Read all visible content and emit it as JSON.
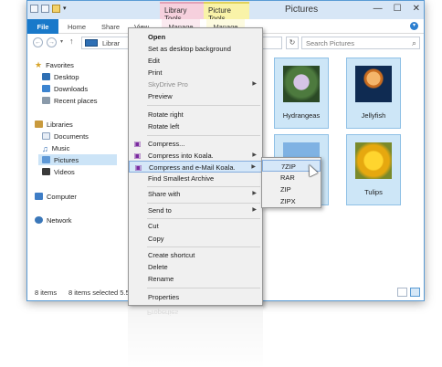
{
  "window": {
    "title": "Pictures",
    "controls": {
      "minimize": "—",
      "maximize": "☐",
      "close": "✕"
    }
  },
  "ribbon": {
    "context_tabs": {
      "library_tools": "Library Tools",
      "picture_tools": "Picture Tools"
    },
    "tabs": {
      "file": "File",
      "home": "Home",
      "share": "Share",
      "view": "View",
      "manage1": "Manage",
      "manage2": "Manage"
    }
  },
  "address": {
    "path": "Librar",
    "search_placeholder": "Search Pictures"
  },
  "navpane": {
    "favorites": "Favorites",
    "desktop": "Desktop",
    "downloads": "Downloads",
    "recent": "Recent places",
    "libraries": "Libraries",
    "documents": "Documents",
    "music": "Music",
    "pictures": "Pictures",
    "videos": "Videos",
    "computer": "Computer",
    "network": "Network"
  },
  "files": [
    {
      "name": "Hydrangeas",
      "icon": "hydrangeas-thumbnail"
    },
    {
      "name": "Jellyfish",
      "icon": "jellyfish-thumbnail"
    },
    {
      "name": "",
      "icon": "penguins-thumbnail"
    },
    {
      "name": "Tulips",
      "icon": "tulips-thumbnail"
    }
  ],
  "status": {
    "count": "8 items",
    "selected": "8 items selected  5.5"
  },
  "context_menu": {
    "open": "Open",
    "set_desktop": "Set as desktop background",
    "edit": "Edit",
    "print": "Print",
    "skydrive": "SkyDrive Pro",
    "preview": "Preview",
    "rotate_right": "Rotate right",
    "rotate_left": "Rotate left",
    "compress": "Compress...",
    "compress_koala": "Compress into Koala.",
    "compress_email": "Compress and e-Mail Koala.",
    "find_smallest": "Find Smallest Archive",
    "share_with": "Share with",
    "send_to": "Send to",
    "cut": "Cut",
    "copy": "Copy",
    "create_shortcut": "Create shortcut",
    "delete": "Delete",
    "rename": "Rename",
    "properties": "Properties"
  },
  "submenu": {
    "7zip": "7ZIP",
    "rar": "RAR",
    "zip": "ZIP",
    "zipx": "ZIPX"
  },
  "reflection_text": "Properties"
}
